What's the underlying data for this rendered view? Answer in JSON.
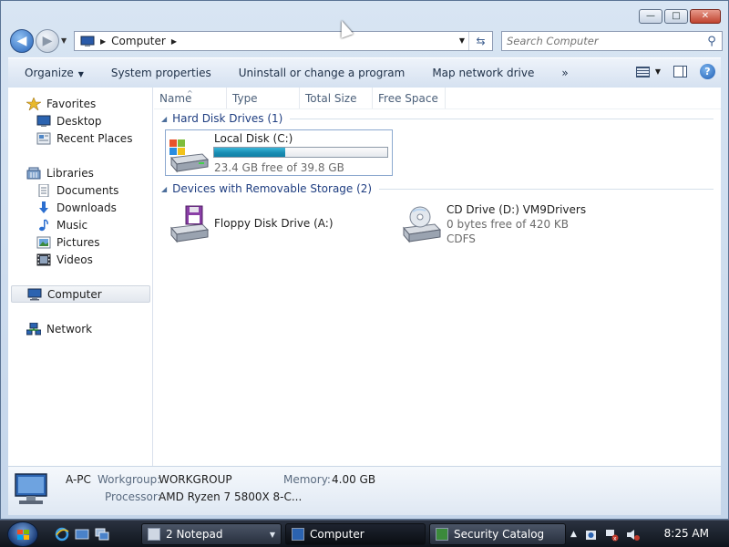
{
  "window": {
    "controls": {
      "minimize": "—",
      "maximize": "□",
      "close": "✕"
    }
  },
  "nav": {
    "back_icon": "back-arrow-icon",
    "forward_icon": "forward-arrow-icon",
    "address": {
      "crumb": "Computer"
    },
    "search": {
      "placeholder": "Search Computer"
    }
  },
  "toolbar": {
    "organize": "Organize",
    "system_properties": "System properties",
    "uninstall": "Uninstall or change a program",
    "map_network": "Map network drive",
    "more": "»"
  },
  "sidebar": {
    "favorites": "Favorites",
    "desktop": "Desktop",
    "recent_places": "Recent Places",
    "libraries": "Libraries",
    "documents": "Documents",
    "downloads": "Downloads",
    "music": "Music",
    "pictures": "Pictures",
    "videos": "Videos",
    "computer": "Computer",
    "network": "Network"
  },
  "columns": {
    "name": "Name",
    "type": "Type",
    "total_size": "Total Size",
    "free_space": "Free Space"
  },
  "groups": {
    "hard_disk": "Hard Disk Drives (1)",
    "removable": "Devices with Removable Storage (2)"
  },
  "drives": {
    "local": {
      "name": "Local Disk (C:)",
      "free": "23.4 GB free of 39.8 GB",
      "used_fraction": 0.41
    },
    "floppy": {
      "name": "Floppy Disk Drive (A:)"
    },
    "cd": {
      "name": "CD Drive (D:) VM9Drivers",
      "free": "0 bytes free of 420 KB",
      "fs": "CDFS"
    }
  },
  "details": {
    "computer_name": "A-PC",
    "workgroup_label": "Workgroup:",
    "workgroup_value": "WORKGROUP",
    "memory_label": "Memory:",
    "memory_value": "4.00 GB",
    "processor_label": "Processor:",
    "processor_value": "AMD Ryzen 7 5800X 8-C..."
  },
  "taskbar": {
    "notepad": "2 Notepad",
    "computer": "Computer",
    "security": "Security Catalog",
    "clock": "8:25 AM"
  },
  "colors": {
    "accent": "#1e3d80",
    "progress": "#1a8db3",
    "taskbar": "#1a202b"
  }
}
